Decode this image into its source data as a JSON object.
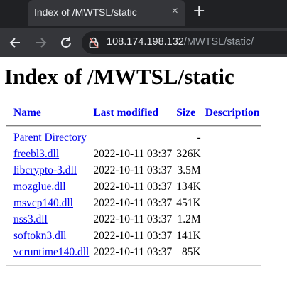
{
  "browser": {
    "tab_title": "Index of /MWTSL/static",
    "close_glyph": "×",
    "newtab_glyph": "+",
    "url_host": "108.174.198.132",
    "url_path": "/MWTSL/static/"
  },
  "page": {
    "heading": "Index of /MWTSL/static",
    "columns": {
      "name": "Name",
      "modified": "Last modified",
      "size": "Size",
      "description": "Description"
    },
    "parent": {
      "name": "Parent Directory",
      "modified": "",
      "size": "-"
    },
    "files": [
      {
        "name": "freebl3.dll",
        "modified": "2022-10-11 03:37",
        "size": "326K"
      },
      {
        "name": "libcrypto-3.dll",
        "modified": "2022-10-11 03:37",
        "size": "3.5M"
      },
      {
        "name": "mozglue.dll",
        "modified": "2022-10-11 03:37",
        "size": "134K"
      },
      {
        "name": "msvcp140.dll",
        "modified": "2022-10-11 03:37",
        "size": "451K"
      },
      {
        "name": "nss3.dll",
        "modified": "2022-10-11 03:37",
        "size": "1.2M"
      },
      {
        "name": "softokn3.dll",
        "modified": "2022-10-11 03:37",
        "size": "141K"
      },
      {
        "name": "vcruntime140.dll",
        "modified": "2022-10-11 03:37",
        "size": "85K"
      }
    ]
  }
}
